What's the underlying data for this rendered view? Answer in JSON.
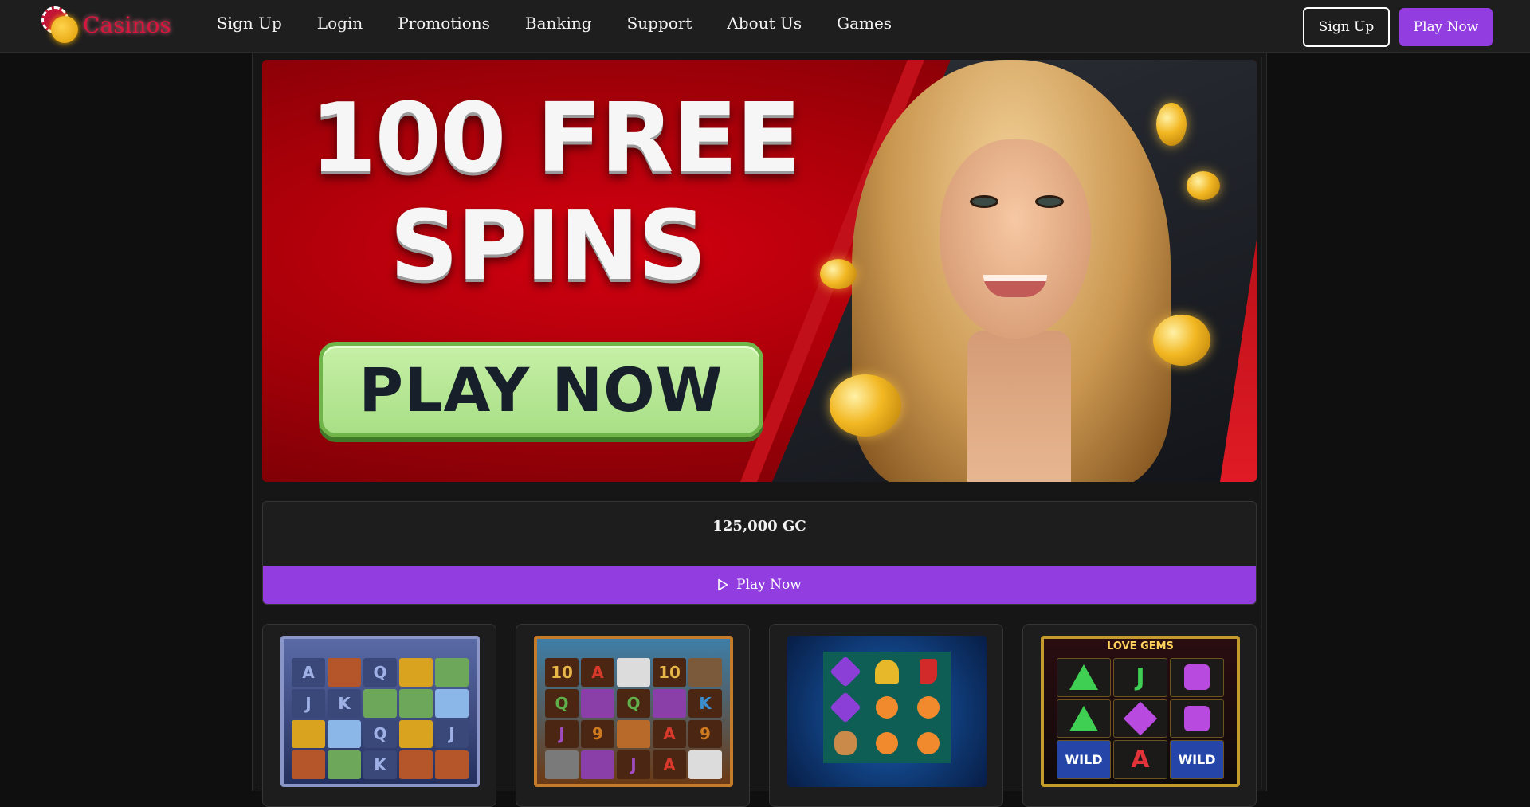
{
  "brand": {
    "name": "Casinos"
  },
  "nav": [
    {
      "label": "Sign Up"
    },
    {
      "label": "Login"
    },
    {
      "label": "Promotions"
    },
    {
      "label": "Banking"
    },
    {
      "label": "Support"
    },
    {
      "label": "About Us"
    },
    {
      "label": "Games"
    }
  ],
  "header_actions": {
    "signup_label": "Sign Up",
    "play_label": "Play Now"
  },
  "banner": {
    "line1": "100 FREE",
    "line2": "SPINS",
    "cta_label": "PLAY NOW"
  },
  "balance": {
    "value": "125,000 GC",
    "play_label": "Play Now"
  },
  "games": [
    {
      "title": "",
      "symbols": [
        "A",
        "",
        "Q",
        "",
        "",
        "J",
        "K",
        "",
        "",
        "",
        "",
        "",
        "Q",
        "",
        "J",
        "",
        "",
        "K",
        "",
        ""
      ]
    },
    {
      "title": "",
      "symbols": [
        "10",
        "A",
        "",
        "10",
        "",
        "Q",
        "",
        "Q",
        "",
        "K",
        "J",
        "9",
        "",
        "A",
        "9",
        "",
        "",
        "J",
        "A",
        ""
      ]
    },
    {
      "title": "",
      "symbols": [
        "",
        "",
        "",
        "",
        "",
        "",
        "",
        "",
        ""
      ]
    },
    {
      "title": "LOVE GEMS",
      "symbols": [
        "",
        "J",
        "",
        "",
        "",
        "",
        "WILD",
        "A",
        "WILD"
      ]
    }
  ],
  "colors": {
    "accent": "#913de0",
    "brand_red": "#d6163c",
    "header_bg": "#1e1e1f",
    "page_bg": "#0f0f10"
  }
}
